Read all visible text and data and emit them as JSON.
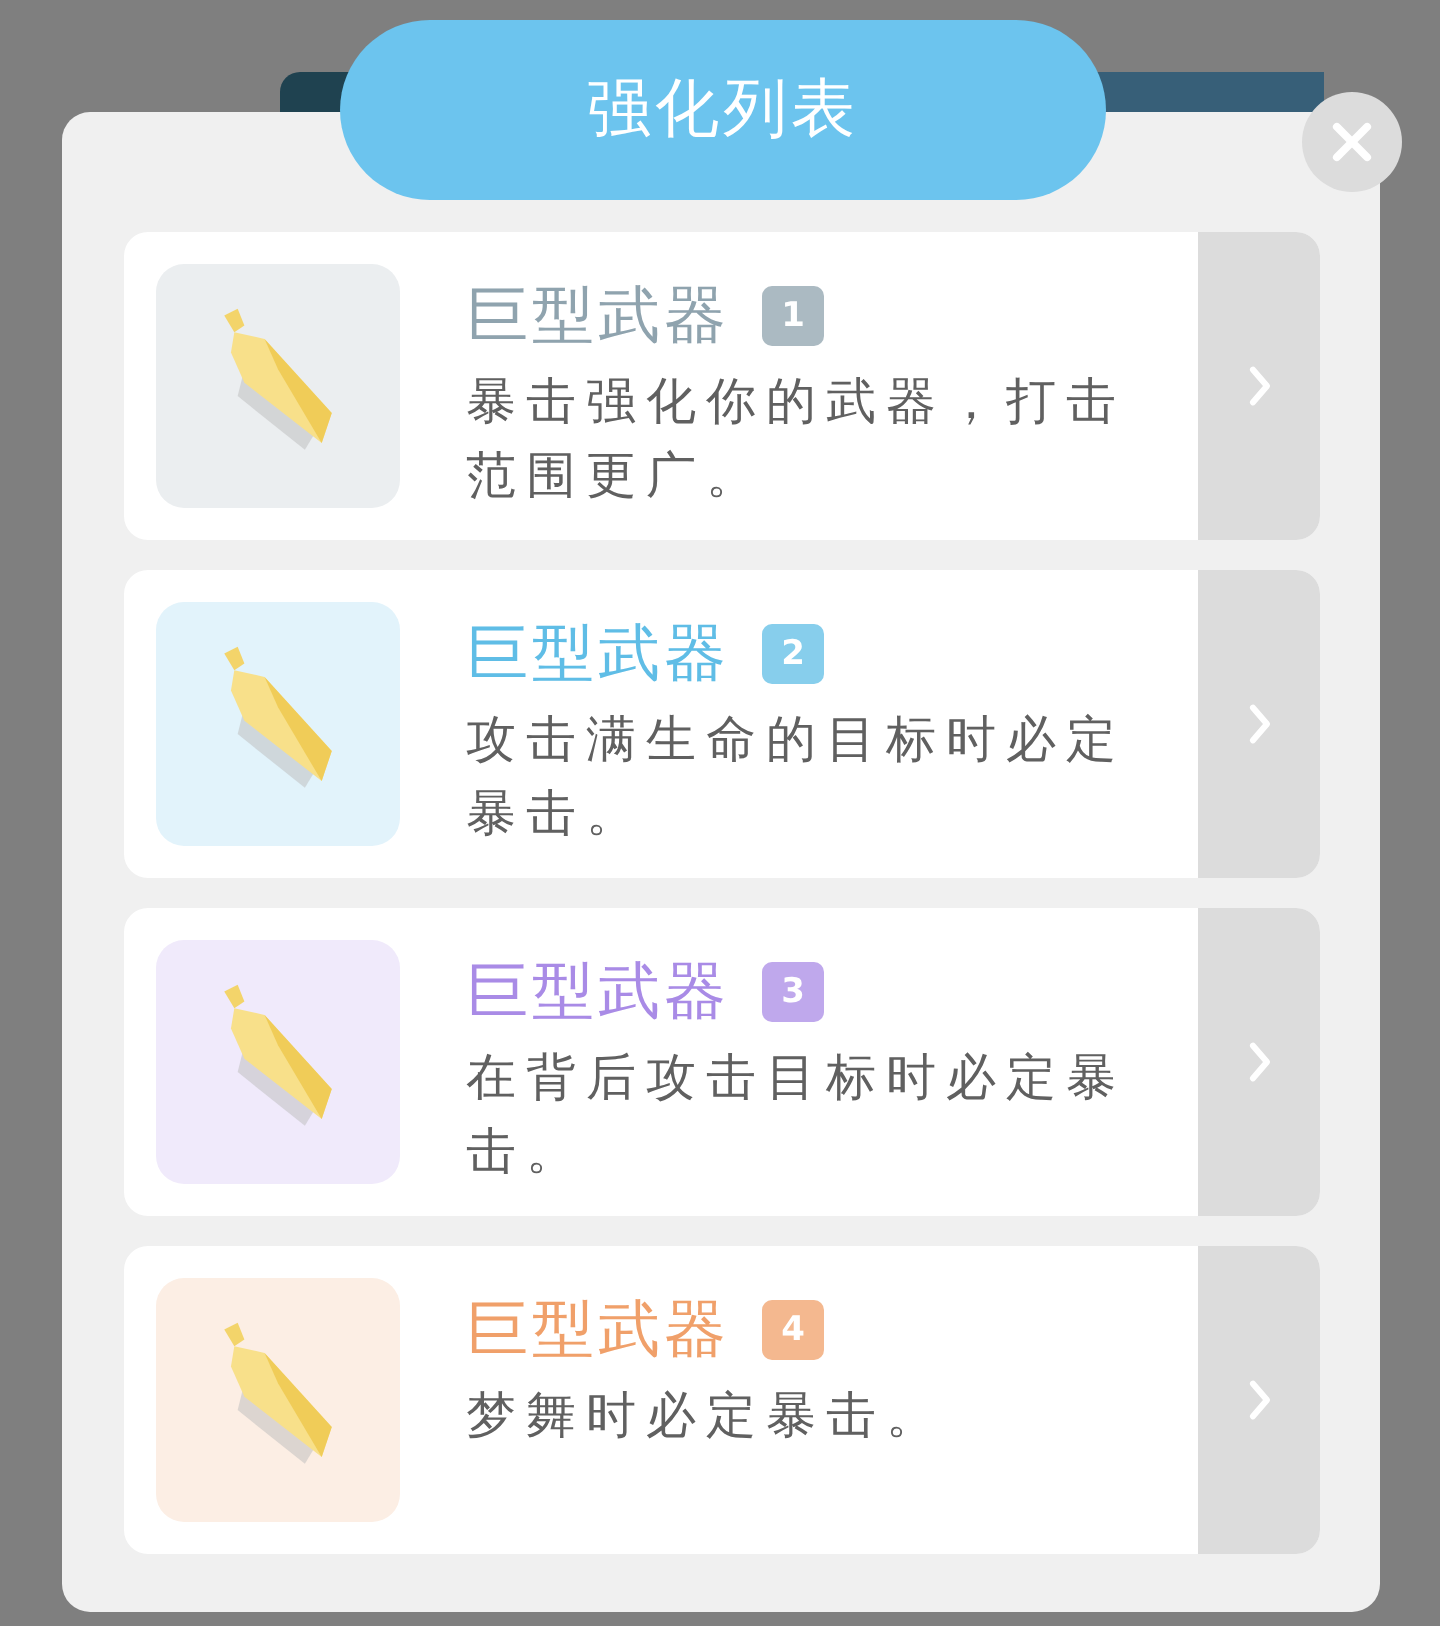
{
  "dialog": {
    "title": "强化列表"
  },
  "upgrades": [
    {
      "name": "巨型武器",
      "badge": "1",
      "description": "暴击强化你的武器，打击范围更广。",
      "color": "#8fa3ae"
    },
    {
      "name": "巨型武器",
      "badge": "2",
      "description": "攻击满生命的目标时必定暴击。",
      "color": "#5fbde6"
    },
    {
      "name": "巨型武器",
      "badge": "3",
      "description": "在背后攻击目标时必定暴击。",
      "color": "#a98be6"
    },
    {
      "name": "巨型武器",
      "badge": "4",
      "description": "梦舞时必定暴击。",
      "color": "#f0a06a"
    }
  ]
}
